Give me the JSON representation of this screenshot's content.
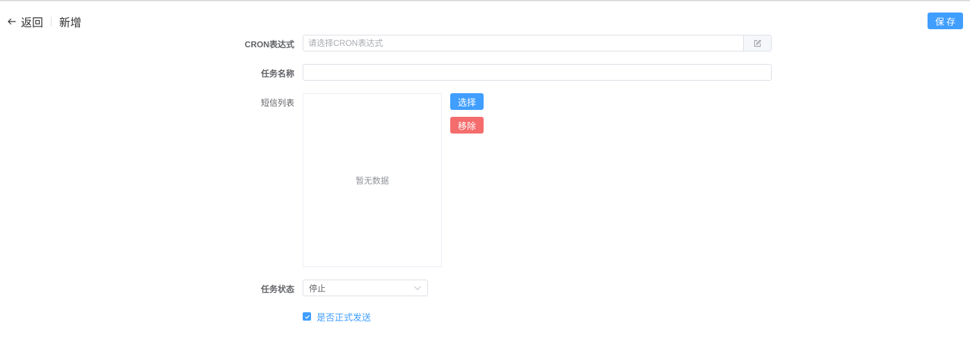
{
  "header": {
    "back_label": "返回",
    "title": "新增",
    "save_label": "保存"
  },
  "form": {
    "cron": {
      "label": "CRON表达式",
      "value": "",
      "placeholder": "请选择CRON表达式",
      "append_icon": "edit-icon"
    },
    "task_name": {
      "label": "任务名称",
      "value": ""
    },
    "sms_list": {
      "label": "短信列表",
      "empty_text": "暂无数据",
      "select_label": "选择",
      "remove_label": "移除"
    },
    "task_status": {
      "label": "任务状态",
      "selected": "停止",
      "icon": "chevron-down-icon"
    },
    "formal_send": {
      "label": "是否正式发送",
      "checked": true
    }
  },
  "colors": {
    "primary": "#409eff",
    "danger": "#f56c6c",
    "border": "#dcdfe6",
    "label": "#606266"
  }
}
